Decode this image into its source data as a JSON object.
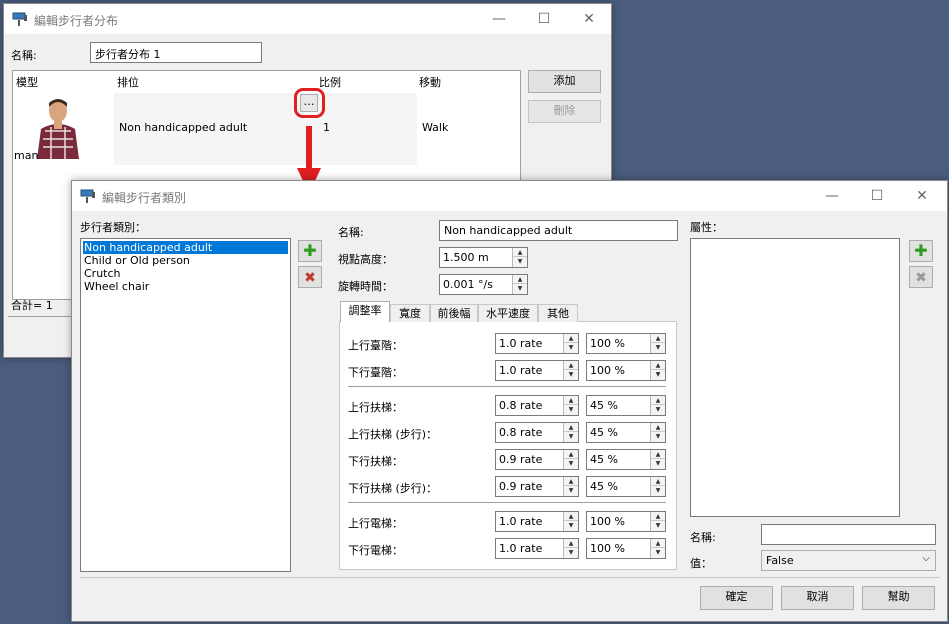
{
  "back_window": {
    "title": "編輯步行者分布",
    "name_label": "名稱:",
    "name_value": "步行者分布 1",
    "columns": [
      "模型",
      "排位",
      "比例",
      "移動"
    ],
    "row": {
      "model": "man",
      "category": "Non handicapped adult",
      "ellipsis": "…",
      "ratio": "1",
      "move": "Walk"
    },
    "add_button": "添加",
    "delete_button": "刪除",
    "total": "合計= 1"
  },
  "front_window": {
    "title": "編輯步行者類別",
    "category_list_label": "步行者類別：",
    "categories": [
      "Non handicapped adult",
      "Child or Old person",
      "Crutch",
      "Wheel chair"
    ],
    "selected_index": 0,
    "name_label": "名稱:",
    "name_value": "Non handicapped adult",
    "eye_height_label": "視點高度：",
    "eye_height_value": "1.500 m",
    "rotation_label": "旋轉時間：",
    "rotation_value": "0.001 °/s",
    "tabs": [
      "調整率",
      "寬度",
      "前後幅",
      "水平速度",
      "其他"
    ],
    "rows": [
      {
        "label": "上行臺階：",
        "rate": "1.0 rate",
        "pct": "100 %"
      },
      {
        "label": "下行臺階：",
        "rate": "1.0 rate",
        "pct": "100 %"
      },
      {
        "label": "上行扶梯：",
        "rate": "0.8 rate",
        "pct": "45 %"
      },
      {
        "label": "上行扶梯 (步行)：",
        "rate": "0.8 rate",
        "pct": "45 %"
      },
      {
        "label": "下行扶梯：",
        "rate": "0.9 rate",
        "pct": "45 %"
      },
      {
        "label": "下行扶梯 (步行)：",
        "rate": "0.9 rate",
        "pct": "45 %"
      },
      {
        "label": "上行電梯：",
        "rate": "1.0 rate",
        "pct": "100 %"
      },
      {
        "label": "下行電梯：",
        "rate": "1.0 rate",
        "pct": "100 %"
      }
    ],
    "attr_label": "屬性：",
    "attr_name_label": "名稱:",
    "attr_name_value": "",
    "attr_value_label": "值：",
    "attr_value": "False",
    "ok_button": "確定",
    "cancel_button": "取消",
    "help_button": "幫助"
  },
  "icons": {
    "window_icon": "paint-roller-icon",
    "add": "plus-icon",
    "remove": "x-icon",
    "arrow": "down-arrow-annotation",
    "highlight": "red-rounded-rectangle-highlight"
  },
  "colors": {
    "selection": "#0078d7",
    "add_green": "#2e9b1f",
    "remove_red": "#c0392b",
    "annotation_red": "#e02020"
  }
}
